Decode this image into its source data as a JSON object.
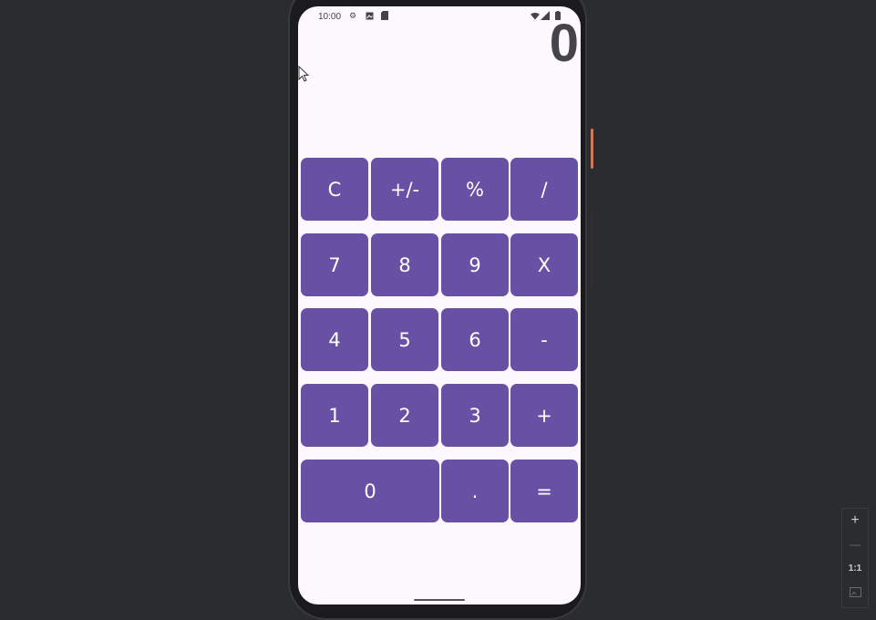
{
  "status_bar": {
    "time": "10:00",
    "left_icons": [
      "gear-icon",
      "image-icon",
      "sd-card-icon"
    ],
    "right_icons": [
      "wifi-icon",
      "signal-icon",
      "battery-icon"
    ]
  },
  "display": {
    "value": "0"
  },
  "keypad": {
    "rows": [
      [
        "C",
        "+/-",
        "%",
        "/"
      ],
      [
        "7",
        "8",
        "9",
        "X"
      ],
      [
        "4",
        "5",
        "6",
        "-"
      ],
      [
        "1",
        "2",
        "3",
        "+"
      ],
      [
        "0",
        ".",
        "="
      ]
    ]
  },
  "colors": {
    "key_bg": "#6850a4",
    "key_text": "#ffffff",
    "screen_bg": "#fdf8fd",
    "display_text": "#44444a",
    "backdrop": "#2b2c30"
  },
  "zoom_controls": {
    "zoom_in": "+",
    "zoom_out": "—",
    "actual_size": "1:1"
  }
}
